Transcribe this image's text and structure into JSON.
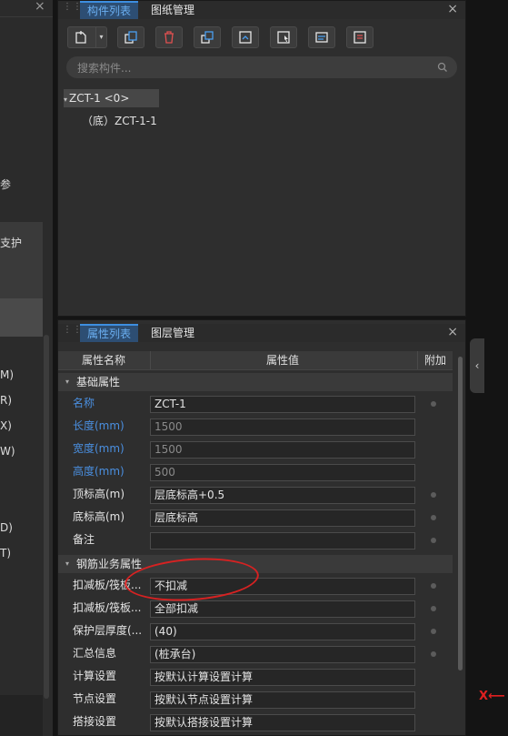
{
  "left_panel": {
    "close_glyph": "×",
    "items": [
      "参",
      "支护",
      "M)",
      "R)",
      "X)",
      "W)",
      "D)",
      "T)"
    ]
  },
  "component_panel": {
    "tabs": [
      "构件列表",
      "图纸管理"
    ],
    "close_glyph": "×",
    "search_placeholder": "搜索构件...",
    "tree": {
      "root": "ZCT-1 <0>",
      "child": "（底）ZCT-1-1"
    }
  },
  "property_panel": {
    "tabs": [
      "属性列表",
      "图层管理"
    ],
    "close_glyph": "×",
    "columns": [
      "属性名称",
      "属性值",
      "附加"
    ],
    "groups": [
      {
        "label": "基础属性",
        "rows": [
          {
            "name": "名称",
            "value": "ZCT-1",
            "blue": true,
            "muted": false,
            "dot": true
          },
          {
            "name": "长度(mm)",
            "value": "1500",
            "blue": true,
            "muted": true,
            "dot": false
          },
          {
            "name": "宽度(mm)",
            "value": "1500",
            "blue": true,
            "muted": true,
            "dot": false
          },
          {
            "name": "高度(mm)",
            "value": "500",
            "blue": true,
            "muted": true,
            "dot": false
          },
          {
            "name": "顶标高(m)",
            "value": "层底标高+0.5",
            "blue": false,
            "muted": false,
            "dot": true
          },
          {
            "name": "底标高(m)",
            "value": "层底标高",
            "blue": false,
            "muted": false,
            "dot": true
          },
          {
            "name": "备注",
            "value": "",
            "blue": false,
            "muted": false,
            "dot": true
          }
        ]
      },
      {
        "label": "钢筋业务属性",
        "rows": [
          {
            "name": "扣减板/筏板...",
            "value": "不扣减",
            "blue": false,
            "muted": false,
            "dot": true
          },
          {
            "name": "扣减板/筏板...",
            "value": "全部扣减",
            "blue": false,
            "muted": false,
            "dot": true
          },
          {
            "name": "保护层厚度(...",
            "value": "(40)",
            "blue": false,
            "muted": false,
            "dot": true
          },
          {
            "name": "汇总信息",
            "value": "(桩承台)",
            "blue": false,
            "muted": false,
            "dot": true
          },
          {
            "name": "计算设置",
            "value": "按默认计算设置计算",
            "blue": false,
            "muted": false,
            "dot": false
          },
          {
            "name": "节点设置",
            "value": "按默认节点设置计算",
            "blue": false,
            "muted": false,
            "dot": false
          },
          {
            "name": "搭接设置",
            "value": "按默认搭接设置计算",
            "blue": false,
            "muted": false,
            "dot": false
          }
        ]
      }
    ]
  },
  "side_tab_glyph": "‹",
  "axis_label": "X",
  "axis_arrow": "⟵",
  "colors": {
    "accent_blue": "#4a8fe0",
    "tab_active_bg": "#2d4e73",
    "annotation_red": "#d62222"
  },
  "icons": [
    "new-component-icon",
    "copy-icon",
    "delete-icon",
    "layer-copy-icon",
    "floor-copy-icon",
    "pick-icon",
    "properties-icon",
    "list-icon",
    "search-icon"
  ]
}
